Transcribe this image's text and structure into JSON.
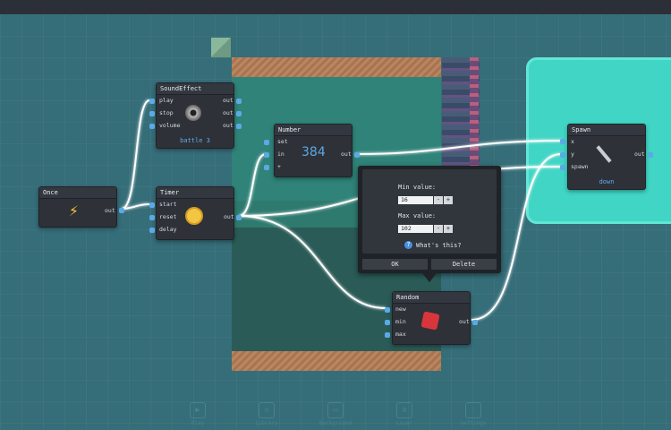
{
  "nodes": {
    "once": {
      "title": "Once",
      "out": "out",
      "icon": "lightning-icon"
    },
    "sound": {
      "title": "SoundEffect",
      "inputs": [
        "play",
        "stop",
        "volume"
      ],
      "outputs": [
        "out",
        "out",
        "out"
      ],
      "caption": "battle 3",
      "icon": "speaker-icon"
    },
    "timer": {
      "title": "Timer",
      "inputs": [
        "start",
        "reset",
        "delay"
      ],
      "out": "out",
      "icon": "alarm-clock-icon"
    },
    "number": {
      "title": "Number",
      "inputs": [
        "set",
        "in",
        "+"
      ],
      "out": "out",
      "value": "384"
    },
    "spawn": {
      "title": "Spawn",
      "inputs": [
        "x",
        "y",
        "spawn"
      ],
      "out": "out",
      "caption": "down",
      "icon": "wand-icon"
    },
    "random": {
      "title": "Random",
      "inputs": [
        "new",
        "min",
        "max"
      ],
      "out": "out",
      "icon": "dice-icon"
    }
  },
  "popup": {
    "min_label": "Min value:",
    "min_value": "16",
    "max_label": "Max value:",
    "max_value": "102",
    "minus": "-",
    "plus": "+",
    "help_icon": "?",
    "help": "What's this?",
    "ok": "OK",
    "delete": "Delete"
  },
  "bottom": [
    "Play",
    "Library",
    "Background",
    "Layer",
    "Settings"
  ],
  "colors": {
    "wire": "#ffffff",
    "wire_glow": "#7fc6ff",
    "accent": "#5ba9e6",
    "spawn_zone": "#40d5c4"
  }
}
